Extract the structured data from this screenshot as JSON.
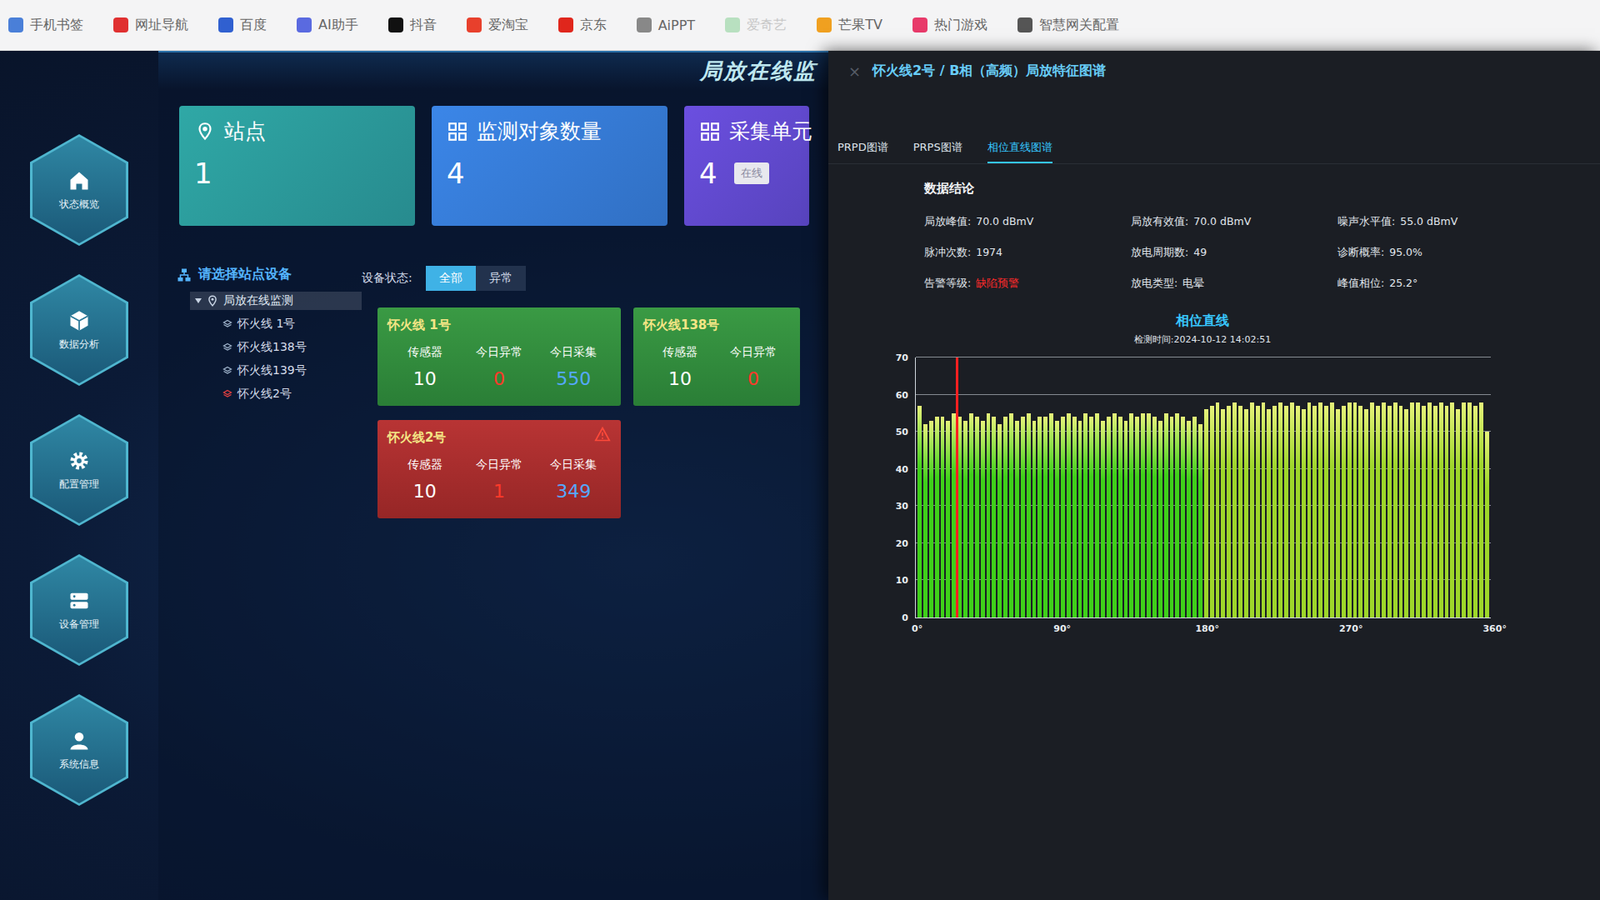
{
  "bookmarks": [
    {
      "label": "手机书签",
      "color": "#4a7fd8"
    },
    {
      "label": "网址导航",
      "color": "#e03030"
    },
    {
      "label": "百度",
      "color": "#3060d0"
    },
    {
      "label": "AI助手",
      "color": "#5a6ae0"
    },
    {
      "label": "抖音",
      "color": "#111111"
    },
    {
      "label": "爱淘宝",
      "color": "#e8402c"
    },
    {
      "label": "京东",
      "color": "#e0261c"
    },
    {
      "label": "AiPPT",
      "color": "#888888"
    },
    {
      "label": "爱奇艺",
      "color": "#b8e0c0"
    },
    {
      "label": "芒果TV",
      "color": "#f0a020"
    },
    {
      "label": "热门游戏",
      "color": "#e83a6a"
    },
    {
      "label": "智慧网关配置",
      "color": "#555555"
    }
  ],
  "app": {
    "title": "局放在线监"
  },
  "sidebar": {
    "items": [
      {
        "label": "状态概览"
      },
      {
        "label": "数据分析"
      },
      {
        "label": "配置管理"
      },
      {
        "label": "设备管理"
      },
      {
        "label": "系统信息"
      }
    ]
  },
  "stats": [
    {
      "title": "站点",
      "value": "1",
      "color": "#2fa8a6"
    },
    {
      "title": "监测对象数量",
      "value": "4",
      "color": "#3b86e8"
    },
    {
      "title": "采集单元",
      "value": "4",
      "badge": "在线",
      "color": "#6b4fe0"
    }
  ],
  "tree": {
    "title": "请选择站点设备",
    "root": {
      "label": "局放在线监测",
      "expanded": true,
      "selected": true
    },
    "children": [
      {
        "label": "怀火线 1号",
        "alarm": false
      },
      {
        "label": "怀火线138号",
        "alarm": false
      },
      {
        "label": "怀火线139号",
        "alarm": false
      },
      {
        "label": "怀火线2号",
        "alarm": true
      }
    ]
  },
  "filter": {
    "label": "设备状态:",
    "options": [
      {
        "label": "全部",
        "selected": true
      },
      {
        "label": "异常",
        "selected": false
      }
    ]
  },
  "devices": [
    {
      "name": "怀火线 1号",
      "alarm": false,
      "stats": [
        {
          "label": "传感器",
          "value": "10"
        },
        {
          "label": "今日异常",
          "value": "0"
        },
        {
          "label": "今日采集",
          "value": "550"
        }
      ]
    },
    {
      "name": "怀火线138号",
      "alarm": false,
      "stats": [
        {
          "label": "传感器",
          "value": "10"
        },
        {
          "label": "今日异常",
          "value": "0"
        }
      ]
    },
    {
      "name": "怀火线2号",
      "alarm": true,
      "stats": [
        {
          "label": "传感器",
          "value": "10"
        },
        {
          "label": "今日异常",
          "value": "1"
        },
        {
          "label": "今日采集",
          "value": "349"
        }
      ]
    }
  ],
  "panel": {
    "close": "×",
    "title": "怀火线2号 / B相（高频）局放特征图谱",
    "tabs": [
      {
        "label": "PRPD图谱",
        "selected": false
      },
      {
        "label": "PRPS图谱",
        "selected": false
      },
      {
        "label": "相位直线图谱",
        "selected": true
      }
    ],
    "conclusion_title": "数据结论",
    "metrics": [
      {
        "label": "局放峰值:",
        "value": "70.0 dBmV",
        "alert": false
      },
      {
        "label": "局放有效值:",
        "value": "70.0 dBmV",
        "alert": false
      },
      {
        "label": "噪声水平值:",
        "value": "55.0 dBmV",
        "alert": false
      },
      {
        "label": "脉冲次数:",
        "value": "1974",
        "alert": false
      },
      {
        "label": "放电周期数:",
        "value": "49",
        "alert": false
      },
      {
        "label": "诊断概率:",
        "value": "95.0%",
        "alert": false
      },
      {
        "label": "告警等级:",
        "value": "缺陷预警",
        "alert": true
      },
      {
        "label": "放电类型:",
        "value": "电晕",
        "alert": false
      },
      {
        "label": "峰值相位:",
        "value": "25.2°",
        "alert": false
      }
    ],
    "chart": {
      "title": "相位直线",
      "subtitle": "检测时间:2024-10-12 14:02:51",
      "y_ticks": [
        "0",
        "10",
        "20",
        "30",
        "40",
        "50",
        "60",
        "70"
      ],
      "x_ticks": [
        "0°",
        "90°",
        "180°",
        "270°",
        "360°"
      ],
      "series": [
        {
          "name": "0-180",
          "color": "#3fd01a",
          "values": [
            57,
            52,
            53,
            54,
            54,
            53,
            55,
            54,
            53,
            55,
            54,
            53,
            55,
            54,
            52,
            54,
            55,
            53,
            54,
            55,
            53,
            54,
            54,
            55,
            53,
            54,
            55,
            54,
            53,
            55,
            54,
            55,
            53,
            54,
            55,
            54,
            53,
            55,
            54,
            55,
            55,
            54,
            53,
            55,
            54,
            55,
            54,
            53,
            54,
            52
          ]
        },
        {
          "name": "180-360",
          "color": "#9ed62a",
          "values": [
            56,
            57,
            58,
            56,
            57,
            58,
            57,
            56,
            58,
            57,
            58,
            56,
            57,
            58,
            57,
            58,
            57,
            56,
            58,
            57,
            58,
            57,
            58,
            56,
            57,
            58,
            58,
            57,
            56,
            58,
            57,
            58,
            57,
            58,
            57,
            56,
            58,
            58,
            57,
            58,
            57,
            58,
            57,
            58,
            56,
            58,
            58,
            57,
            58,
            50
          ]
        }
      ],
      "marker": {
        "phase": 25.2,
        "value": 70,
        "color": "#ff2020"
      }
    }
  }
}
